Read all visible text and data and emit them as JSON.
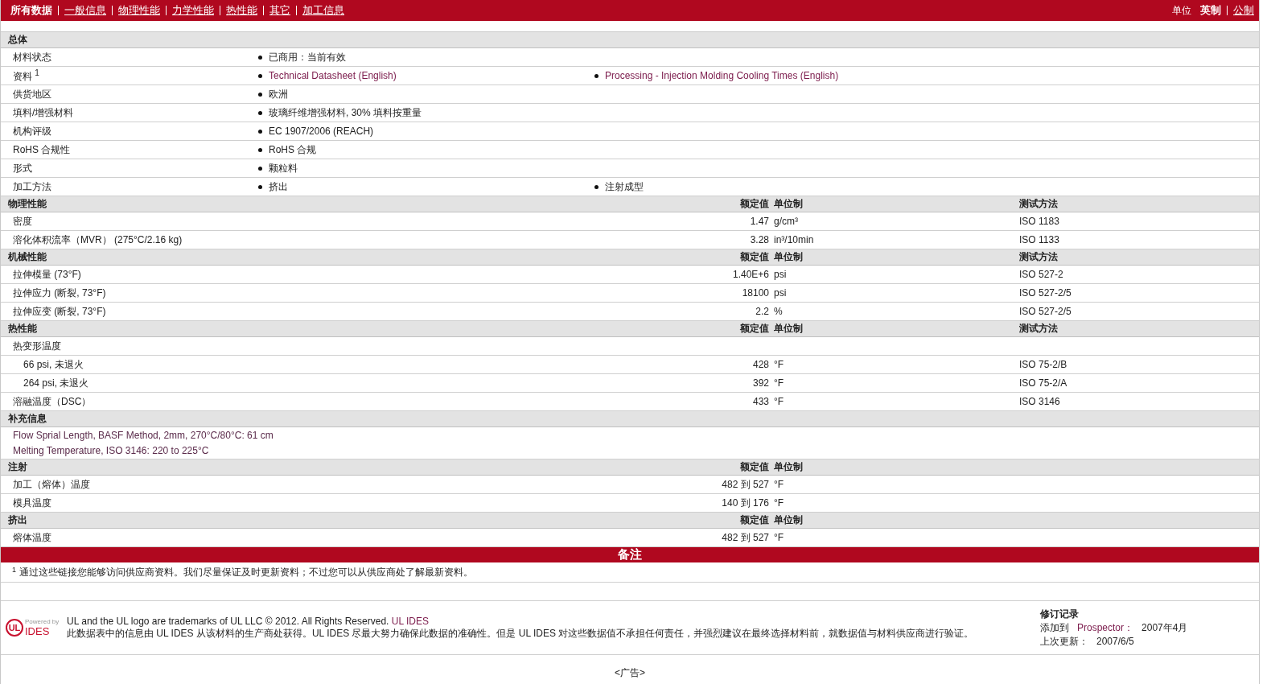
{
  "nav": {
    "tabs": [
      {
        "label": "所有数据",
        "selected": true
      },
      {
        "label": "一般信息",
        "selected": false
      },
      {
        "label": "物理性能",
        "selected": false
      },
      {
        "label": "力学性能",
        "selected": false
      },
      {
        "label": "热性能",
        "selected": false
      },
      {
        "label": "其它",
        "selected": false
      },
      {
        "label": "加工信息",
        "selected": false
      }
    ],
    "units": {
      "label": "单位",
      "options": [
        {
          "label": "英制",
          "selected": true
        },
        {
          "label": "公制",
          "selected": false
        }
      ]
    }
  },
  "sections": [
    {
      "kind": "list",
      "title": "总体",
      "rows": [
        {
          "label": "材料状态",
          "values": [
            {
              "text": "已商用：当前有效",
              "kind": "text"
            }
          ]
        },
        {
          "label": "资料 $^{1}$",
          "values": [
            {
              "text": "Technical Datasheet (English)",
              "kind": "link"
            },
            {
              "text": "Processing - Injection Molding Cooling Times (English)",
              "kind": "link"
            }
          ]
        },
        {
          "label": "供货地区",
          "values": [
            {
              "text": "欧洲",
              "kind": "text"
            }
          ]
        },
        {
          "label": "填料/增强材料",
          "values": [
            {
              "text": "玻璃纤维增强材料, 30% 填料按重量",
              "kind": "text"
            }
          ]
        },
        {
          "label": "机构评级",
          "values": [
            {
              "text": "EC 1907/2006 (REACH)",
              "kind": "text"
            }
          ]
        },
        {
          "label": "RoHS 合规性",
          "values": [
            {
              "text": "RoHS 合规",
              "kind": "text"
            }
          ]
        },
        {
          "label": "形式",
          "values": [
            {
              "text": "颗粒料",
              "kind": "text"
            }
          ]
        },
        {
          "label": "加工方法",
          "values": [
            {
              "text": "挤出",
              "kind": "text"
            },
            {
              "text": "注射成型",
              "kind": "text"
            }
          ]
        }
      ]
    },
    {
      "kind": "property",
      "title": "物理性能",
      "columns": [
        "额定值",
        "单位制",
        "测试方法"
      ],
      "rows": [
        {
          "label": "密度",
          "value": "1.47",
          "unit": "g/cm³",
          "method": "ISO 1183"
        },
        {
          "label": "溶化体积流率（MVR） (275°C/2.16 kg)",
          "value": "3.28",
          "unit": "in³/10min",
          "method": "ISO 1133"
        }
      ]
    },
    {
      "kind": "property",
      "title": "机械性能",
      "columns": [
        "额定值",
        "单位制",
        "测试方法"
      ],
      "rows": [
        {
          "label": "拉伸模量 (73°F)",
          "value": "1.40E+6",
          "unit": "psi",
          "method": "ISO 527-2"
        },
        {
          "label": "拉伸应力 (断裂, 73°F)",
          "value": "18100",
          "unit": "psi",
          "method": "ISO 527-2/5"
        },
        {
          "label": "拉伸应变 (断裂, 73°F)",
          "value": "2.2",
          "unit": "%",
          "method": "ISO 527-2/5"
        }
      ]
    },
    {
      "kind": "property",
      "title": "热性能",
      "columns": [
        "额定值",
        "单位制",
        "测试方法"
      ],
      "rows": [
        {
          "label": "热变形温度",
          "children": [
            {
              "label": "66 psi, 未退火",
              "value": "428",
              "unit": "°F",
              "method": "ISO 75-2/B"
            },
            {
              "label": "264 psi, 未退火",
              "value": "392",
              "unit": "°F",
              "method": "ISO 75-2/A"
            }
          ]
        },
        {
          "label": "溶融温度（DSC）",
          "value": "433",
          "unit": "°F",
          "method": "ISO 3146"
        }
      ]
    },
    {
      "kind": "notes",
      "title": "补充信息",
      "lines": [
        "Flow Sprial Length, BASF Method, 2mm, 270°C/80°C: 61 cm",
        "Melting Temperature, ISO 3146: 220 to 225°C"
      ]
    },
    {
      "kind": "property",
      "title": "注射",
      "columns": [
        "额定值",
        "单位制"
      ],
      "rows": [
        {
          "label": "加工（熔体）温度",
          "value": "482 到  527",
          "unit": "°F"
        },
        {
          "label": "模具温度",
          "value": "140 到  176",
          "unit": "°F"
        }
      ]
    },
    {
      "kind": "property",
      "title": "挤出",
      "columns": [
        "额定值",
        "单位制"
      ],
      "rows": [
        {
          "label": "熔体温度",
          "value": "482 到  527",
          "unit": "°F"
        }
      ]
    }
  ],
  "remarks": {
    "title": "备注",
    "footnotes": [
      {
        "mark": "1",
        "text": "通过这些链接您能够访问供应商资料。我们尽量保证及时更新资料；不过您可以从供应商处了解最新资料。"
      }
    ]
  },
  "footer": {
    "logo": {
      "caption": "Powered by",
      "mark": "UL",
      "name": "IDES"
    },
    "trademark": "UL and the UL logo are trademarks of UL LLC © 2012. All Rights Reserved.",
    "trademark_link": "UL IDES",
    "disclaimer": "此数据表中的信息由 UL IDES 从该材料的生产商处获得。UL IDES 尽最大努力确保此数据的准确性。但是 UL IDES 对这些数据值不承担任何责任，并强烈建议在最终选择材料前，就数据值与材料供应商进行验证。",
    "revision": {
      "title": "修订记录",
      "items": [
        {
          "label": "添加到",
          "link": "Prospector：",
          "value": "2007年4月"
        },
        {
          "label": "上次更新：",
          "value": "2007/6/5"
        }
      ]
    }
  },
  "ad": "<广告>"
}
